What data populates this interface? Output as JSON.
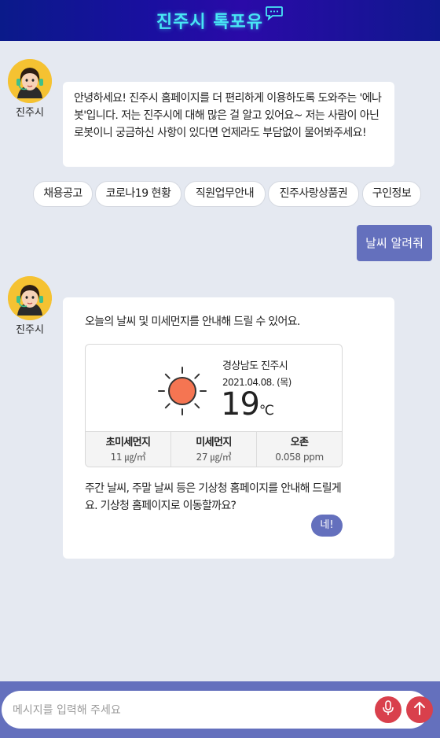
{
  "header": {
    "title": "진주시 톡포유",
    "icon": "speech-bubble-icon",
    "accent": "#48e6f5"
  },
  "bot": {
    "name": "진주시",
    "avatar": "chatbot-avatar"
  },
  "messages": {
    "greeting": "안녕하세요! 진주시 홈페이지를 더 편리하게 이용하도록 도와주는 '에나봇'입니다. 저는 진주시에 대해 많은 걸 알고 있어요~ 저는 사람이 아닌 로봇이니 궁금하신 사항이 있다면 언제라도 부담없이 물어봐주세요!",
    "user": "날씨 알려줘",
    "weather_intro": "오늘의 날씨 및 미세먼지를 안내해 드릴 수 있어요.",
    "weather_after": "주간 날씨, 주말 날씨 등은 기상청 홈페이지를 안내해 드릴게요. 기상청 홈페이지로 이동할까요?",
    "yes_label": "네!"
  },
  "quick_replies": [
    "채용공고",
    "코로나19 현황",
    "직원업무안내",
    "진주사랑상품권",
    "구인정보"
  ],
  "weather": {
    "location": "경상남도 진주시",
    "date": "2021.04.08. (목)",
    "temperature": "19",
    "unit": "℃",
    "icon": "sun-icon",
    "stats": [
      {
        "label": "초미세먼지",
        "value": "11 ㎍/㎥"
      },
      {
        "label": "미세먼지",
        "value": "27 ㎍/㎥"
      },
      {
        "label": "오존",
        "value": "0.058 ppm"
      }
    ]
  },
  "input": {
    "placeholder": "메시지를 입력해 주세요",
    "value": ""
  },
  "colors": {
    "primary": "#6470bd",
    "action": "#d9404c",
    "background": "#e5e9f1"
  }
}
